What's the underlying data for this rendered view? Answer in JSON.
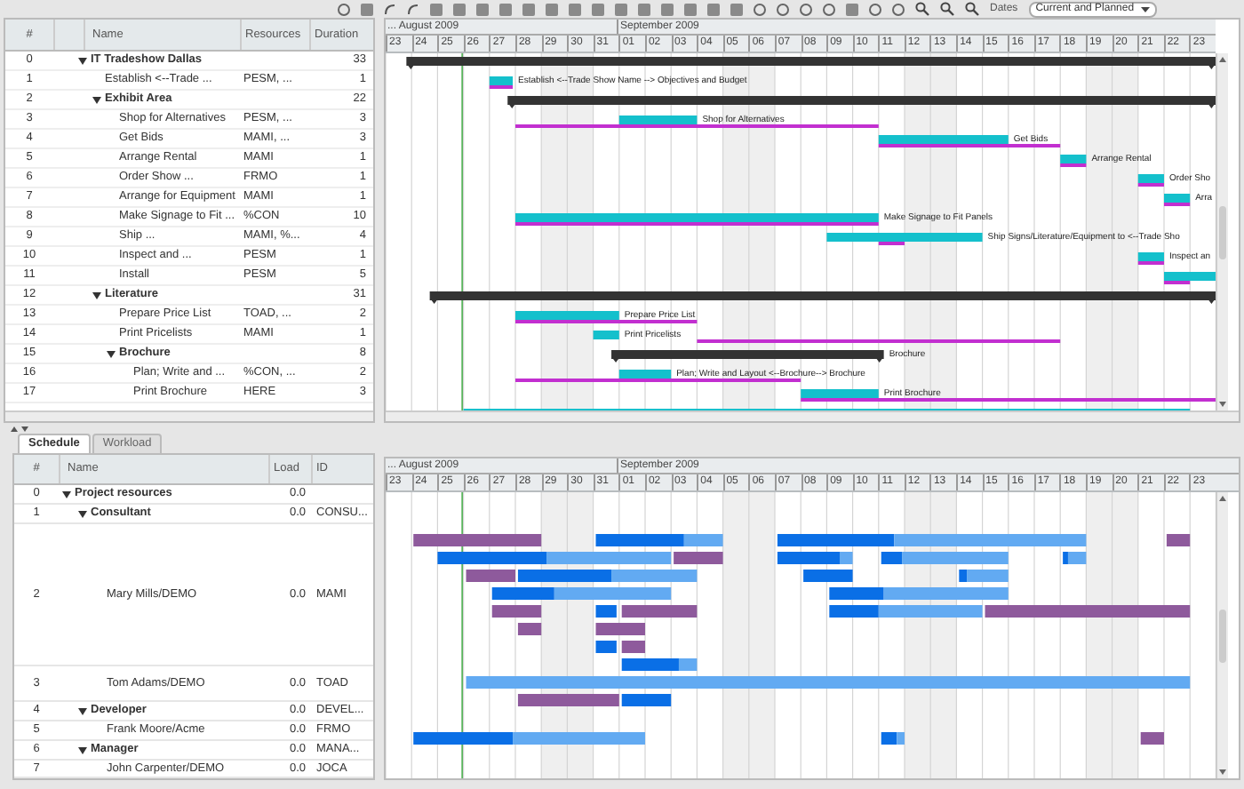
{
  "toolbar": {
    "dates_label": "Dates",
    "dates_value": "Current and Planned"
  },
  "tasks": {
    "columns": [
      "#",
      "Name",
      "Resources",
      "Duration"
    ],
    "months": [
      "... August 2009",
      "September 2009"
    ],
    "days": [
      "23",
      "24",
      "25",
      "26",
      "27",
      "28",
      "29",
      "30",
      "31",
      "01",
      "02",
      "03",
      "04",
      "05",
      "06",
      "07",
      "08",
      "09",
      "10",
      "11",
      "12",
      "13",
      "14",
      "15",
      "16",
      "17",
      "18",
      "19",
      "20",
      "21",
      "22",
      "23"
    ],
    "rows": [
      {
        "num": "0",
        "name": "IT Tradeshow Dallas",
        "duration": "33",
        "expanded": true,
        "children": [
          {
            "num": "1",
            "name": "Establish <--Trade ...",
            "resources": "PESM, ...",
            "duration": "1",
            "bar_label": "Establish <--Trade Show Name --> Objectives and Budget"
          },
          {
            "num": "2",
            "name": "Exhibit Area",
            "duration": "22",
            "expanded": true,
            "children": [
              {
                "num": "3",
                "name": "Shop for Alternatives",
                "resources": "PESM, ...",
                "duration": "3",
                "bar_label": "Shop for Alternatives"
              },
              {
                "num": "4",
                "name": "Get Bids",
                "resources": "MAMI, ...",
                "duration": "3",
                "bar_label": "Get Bids"
              },
              {
                "num": "5",
                "name": "Arrange Rental",
                "resources": "MAMI",
                "duration": "1",
                "bar_label": "Arrange Rental"
              },
              {
                "num": "6",
                "name": "Order Show ...",
                "resources": "FRMO",
                "duration": "1",
                "bar_label": "Order Sho"
              },
              {
                "num": "7",
                "name": "Arrange for Equipment",
                "resources": "MAMI",
                "duration": "1",
                "bar_label": "Arra"
              },
              {
                "num": "8",
                "name": "Make Signage to Fit ...",
                "resources": "%CON",
                "duration": "10",
                "bar_label": "Make Signage to Fit Panels"
              },
              {
                "num": "9",
                "name": "Ship ...",
                "resources": "MAMI, %...",
                "duration": "4",
                "bar_label": "Ship Signs/Literature/Equipment to <--Trade Sho"
              },
              {
                "num": "10",
                "name": "Inspect and ...",
                "resources": "PESM",
                "duration": "1",
                "bar_label": "Inspect an"
              },
              {
                "num": "11",
                "name": "Install",
                "resources": "PESM",
                "duration": "5"
              }
            ]
          },
          {
            "num": "12",
            "name": "Literature",
            "duration": "31",
            "expanded": true,
            "children": [
              {
                "num": "13",
                "name": "Prepare Price List",
                "resources": "TOAD, ...",
                "duration": "2",
                "bar_label": "Prepare Price List"
              },
              {
                "num": "14",
                "name": "Print Pricelists",
                "resources": "MAMI",
                "duration": "1",
                "bar_label": "Print Pricelists"
              },
              {
                "num": "15",
                "name": "Brochure",
                "duration": "8",
                "expanded": true,
                "bar_label": "Brochure",
                "children": [
                  {
                    "num": "16",
                    "name": "Plan; Write and ...",
                    "resources": "%CON, ...",
                    "duration": "2",
                    "bar_label": "Plan; Write and Layout <--Brochure--> Brochure"
                  },
                  {
                    "num": "17",
                    "name": "Print Brochure",
                    "resources": "HERE",
                    "duration": "3",
                    "bar_label": "Print Brochure"
                  }
                ]
              }
            ]
          }
        ]
      }
    ]
  },
  "bottom_tabs": [
    {
      "label": "Schedule",
      "selected": true
    },
    {
      "label": "Workload",
      "selected": false
    }
  ],
  "resources": {
    "columns": [
      "#",
      "Name",
      "Load",
      "ID"
    ],
    "months": [
      "... August 2009",
      "September 2009"
    ],
    "days": [
      "23",
      "24",
      "25",
      "26",
      "27",
      "28",
      "29",
      "30",
      "31",
      "01",
      "02",
      "03",
      "04",
      "05",
      "06",
      "07",
      "08",
      "09",
      "10",
      "11",
      "12",
      "13",
      "14",
      "15",
      "16",
      "17",
      "18",
      "19",
      "20",
      "21",
      "22",
      "23"
    ],
    "rows": [
      {
        "num": "0",
        "name": "Project resources",
        "load": "0.0",
        "expanded": true,
        "children": [
          {
            "num": "1",
            "name": "Consultant",
            "load": "0.0",
            "id": "CONSU...",
            "expanded": true,
            "children": [
              {
                "num": "2",
                "name": "Mary Mills/DEMO",
                "load": "0.0",
                "id": "MAMI"
              },
              {
                "num": "3",
                "name": "Tom Adams/DEMO",
                "load": "0.0",
                "id": "TOAD"
              }
            ]
          },
          {
            "num": "4",
            "name": "Developer",
            "load": "0.0",
            "id": "DEVEL...",
            "expanded": true,
            "children": [
              {
                "num": "5",
                "name": "Frank Moore/Acme",
                "load": "0.0",
                "id": "FRMO"
              }
            ]
          },
          {
            "num": "6",
            "name": "Manager",
            "load": "0.0",
            "id": "MANA...",
            "expanded": true,
            "children": [
              {
                "num": "7",
                "name": "John Carpenter/DEMO",
                "load": "0.0",
                "id": "JOCA"
              }
            ]
          }
        ]
      }
    ]
  }
}
